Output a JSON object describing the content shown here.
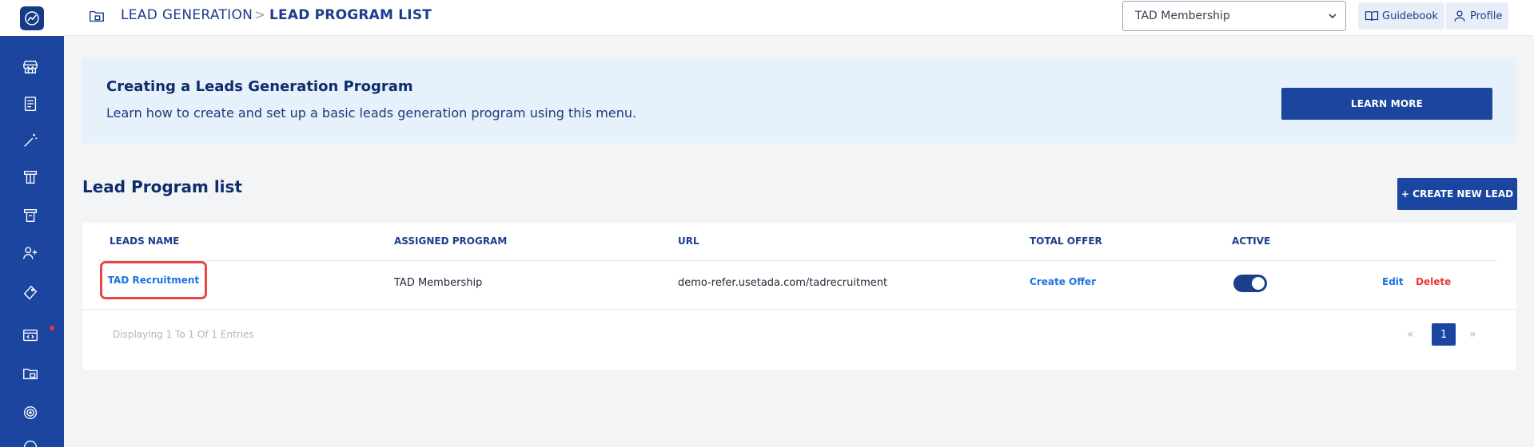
{
  "breadcrumb": {
    "parent": "LEAD GENERATION",
    "separator": ">",
    "current": "LEAD PROGRAM LIST"
  },
  "header": {
    "program_select": {
      "selected": "TAD Membership"
    },
    "guidebook_label": "Guidebook",
    "profile_label": "Profile"
  },
  "sidebar": {
    "icons": [
      "dashboard-store-icon",
      "receipt-icon",
      "magic-wand-icon",
      "voucher-icon",
      "voucher-alt-icon",
      "user-add-icon",
      "tag-icon",
      "code-window-icon",
      "folder-icon",
      "target-icon"
    ],
    "notification_dot_color": "#e53935"
  },
  "banner": {
    "title": "Creating a Leads Generation Program",
    "description": "Learn how to create and set up a basic leads generation program using this menu.",
    "button_label": "LEARN MORE"
  },
  "section": {
    "title": "Lead Program list",
    "create_button_label": "+ CREATE NEW LEAD"
  },
  "table": {
    "columns": [
      "LEADS NAME",
      "ASSIGNED PROGRAM",
      "URL",
      "TOTAL OFFER",
      "ACTIVE"
    ],
    "rows": [
      {
        "leads_name": "TAD Recruitment",
        "assigned_program": "TAD Membership",
        "url": "demo-refer.usetada.com/tadrecruitment",
        "total_offer": "Create Offer",
        "active": true,
        "edit_label": "Edit",
        "delete_label": "Delete"
      }
    ]
  },
  "pagination": {
    "summary": "Displaying 1 To 1 Of 1 Entries",
    "prev": "«",
    "current_page": "1",
    "next": "»"
  },
  "colors": {
    "primary": "#1c45a0",
    "link": "#1a73e8",
    "danger": "#e53935",
    "highlight": "#ef4444",
    "banner_bg": "#e6f1fb"
  }
}
